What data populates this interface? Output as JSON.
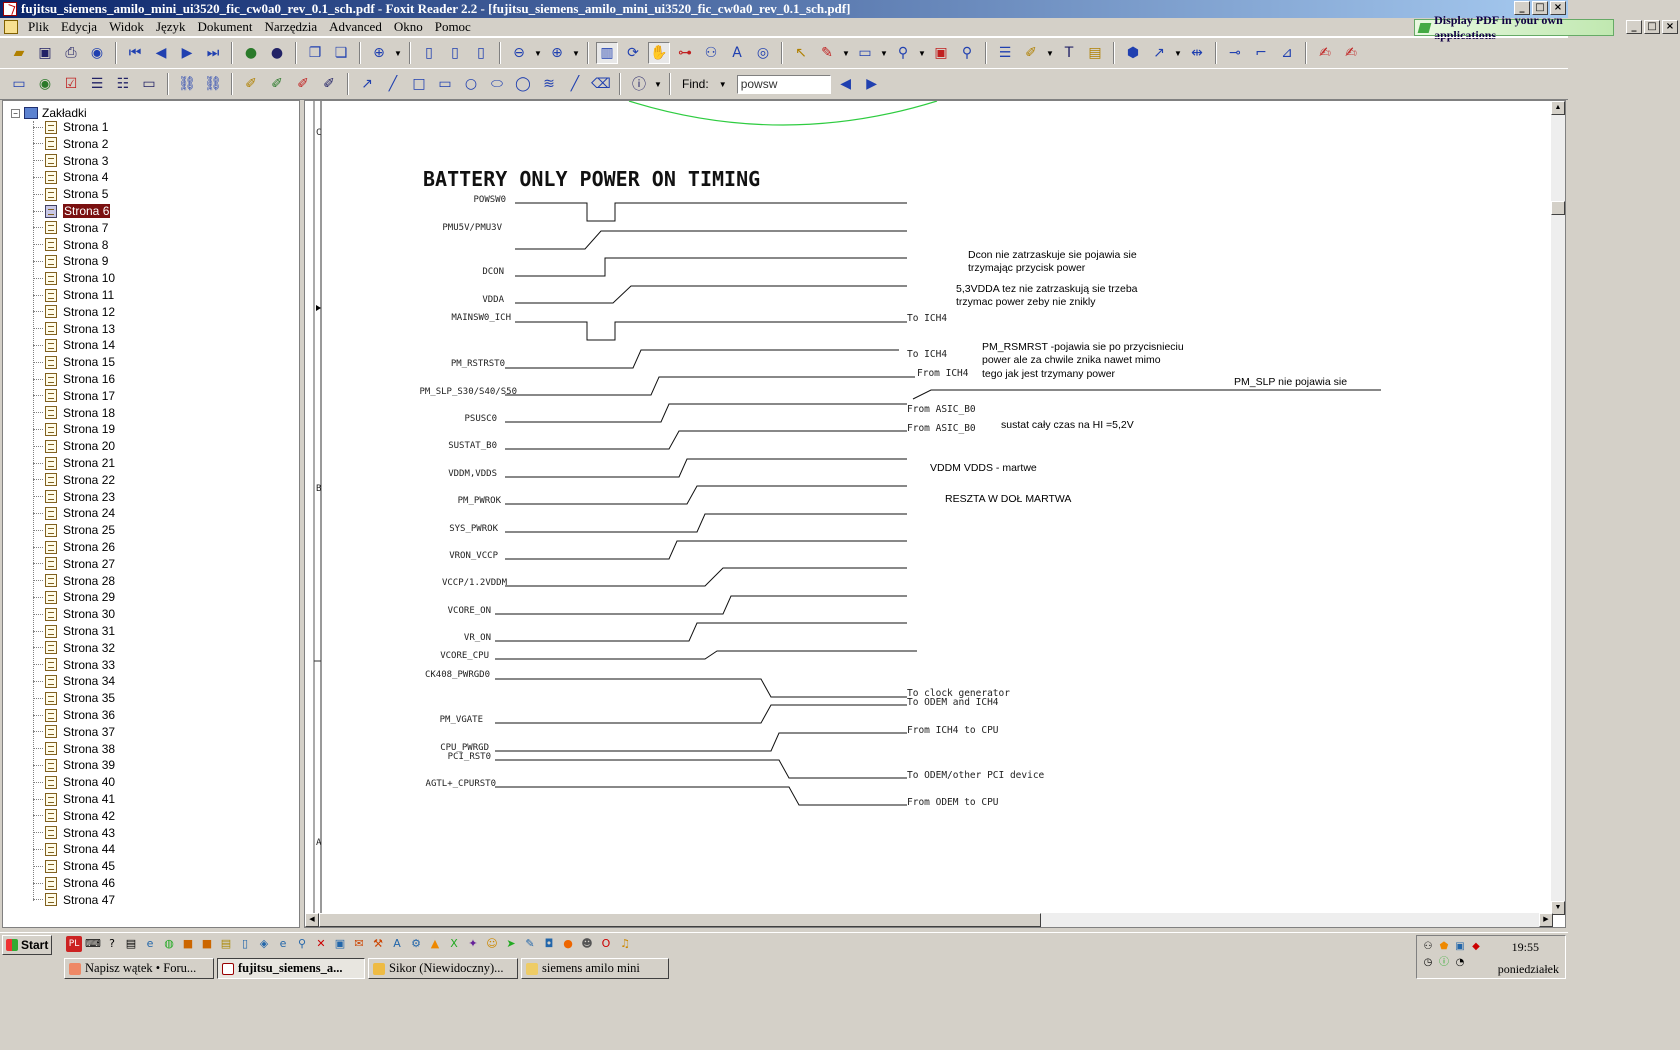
{
  "window": {
    "title": "fujitsu_siemens_amilo_mini_ui3520_fic_cw0a0_rev_0.1_sch.pdf - Foxit Reader 2.2 - [fujitsu_siemens_amilo_mini_ui3520_fic_cw0a0_rev_0.1_sch.pdf]",
    "minimize": "_",
    "maximize": "□",
    "close": "×"
  },
  "menu": {
    "items": [
      "Plik",
      "Edycja",
      "Widok",
      "Język",
      "Dokument",
      "Narzędzia",
      "Advanced",
      "Okno",
      "Pomoc"
    ],
    "display_pdf": "Display PDF in your own applications"
  },
  "toolbar": {
    "find_label": "Find:",
    "find_value": "powsw"
  },
  "sidebar": {
    "root": "Zakładki",
    "selected": "Strona 6",
    "pages": [
      "Strona 1",
      "Strona 2",
      "Strona 3",
      "Strona 4",
      "Strona 5",
      "Strona 6",
      "Strona 7",
      "Strona 8",
      "Strona 9",
      "Strona 10",
      "Strona 11",
      "Strona 12",
      "Strona 13",
      "Strona 14",
      "Strona 15",
      "Strona 16",
      "Strona 17",
      "Strona 18",
      "Strona 19",
      "Strona 20",
      "Strona 21",
      "Strona 22",
      "Strona 23",
      "Strona 24",
      "Strona 25",
      "Strona 26",
      "Strona 27",
      "Strona 28",
      "Strona 29",
      "Strona 30",
      "Strona 31",
      "Strona 32",
      "Strona 33",
      "Strona 34",
      "Strona 35",
      "Strona 36",
      "Strona 37",
      "Strona 38",
      "Strona 39",
      "Strona 40",
      "Strona 41",
      "Strona 42",
      "Strona 43",
      "Strona 44",
      "Strona 45",
      "Strona 46",
      "Strona 47"
    ]
  },
  "document": {
    "heading": "BATTERY ONLY POWER ON TIMING",
    "margin_letters": [
      "C",
      "B",
      "A"
    ],
    "signals": [
      "POWSW0",
      "PMU5V/PMU3V",
      "DCON",
      "VDDA",
      "MAINSW0_ICH",
      "PM_RSTRST0",
      "PM_SLP_S30/S40/S50",
      "PSUSC0",
      "SUSTAT_B0",
      "VDDM,VDDS",
      "PM_PWROK",
      "SYS_PWROK",
      "VRON_VCCP",
      "VCCP/1.2VDDM",
      "VCORE_ON",
      "VR_ON",
      "VCORE_CPU",
      "CK408_PWRGD0",
      "PM_VGATE",
      "CPU_PWRGD",
      "PCI_RST0",
      "AGTL+_CPURST0"
    ],
    "destinations": [
      "To ICH4",
      "To ICH4",
      "From ICH4",
      "From ASIC_B0",
      "From ASIC_B0",
      "To clock generator",
      "To ODEM and ICH4",
      "From ICH4 to CPU",
      "To ODEM/other PCI device",
      "From ODEM to CPU"
    ],
    "notes": [
      "Dcon nie zatrzaskuje sie pojawia sie",
      "trzymając przycisk power",
      "5,3VDDA tez nie zatrzaskują sie trzeba",
      "trzymac power zeby nie znikly",
      "PM_RSMRST -pojawia sie po przycisnieciu",
      "power ale za chwile znika nawet mimo",
      "tego jak jest trzymany power",
      "PM_SLP nie pojawia sie",
      "sustat cały czas na HI =5,2V",
      "VDDM VDDS - martwe",
      "RESZTA W DOŁ MARTWA"
    ]
  },
  "taskbar": {
    "start": "Start",
    "tasks": [
      "Napisz wątek • Foru...",
      "fujitsu_siemens_a...",
      "Sikor (Niewidoczny)...",
      "siemens amilo mini"
    ],
    "clock": "19:55",
    "day": "poniedziałek"
  },
  "colors": {
    "titlebar": "#0a246a",
    "selection": "#7a1010",
    "arc": "#2ecc40"
  }
}
